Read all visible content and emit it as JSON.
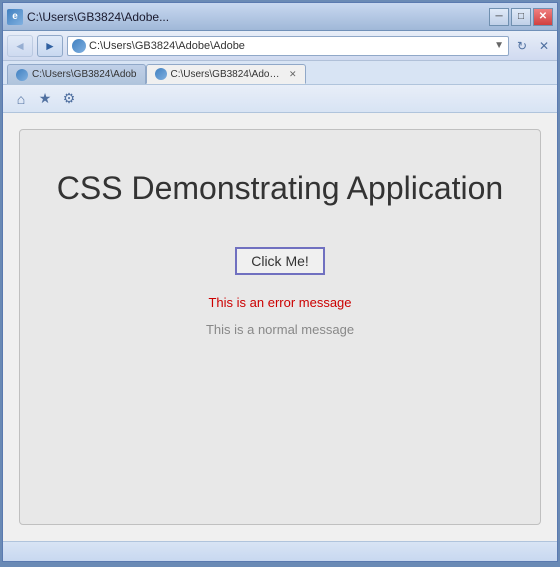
{
  "window": {
    "title": "C:\\Users\\GB3824\\Adobe...",
    "title_bar_text": "C:\\Users\\GB3824\\Adobe..."
  },
  "address_bar": {
    "tab1": {
      "label": "C:\\Users\\GB3824\\Adob",
      "full": "C:\\Users\\GB3824\\Adobe\\Adobe"
    },
    "tab2": {
      "label": "C:\\Users\\GB3824\\Adobe ...",
      "full": "C:\\Users\\GB3824\\Adobe ..."
    }
  },
  "nav": {
    "back_label": "◄",
    "forward_label": "►",
    "refresh_label": "↻",
    "stop_label": "✕"
  },
  "toolbar": {
    "home_label": "⌂",
    "favorites_label": "★",
    "settings_label": "⚙"
  },
  "page": {
    "heading": "CSS Demonstrating Application",
    "button_label": "Click Me!",
    "error_message": "This is an error message",
    "normal_message": "This is a normal message"
  },
  "status": {
    "text": ""
  }
}
